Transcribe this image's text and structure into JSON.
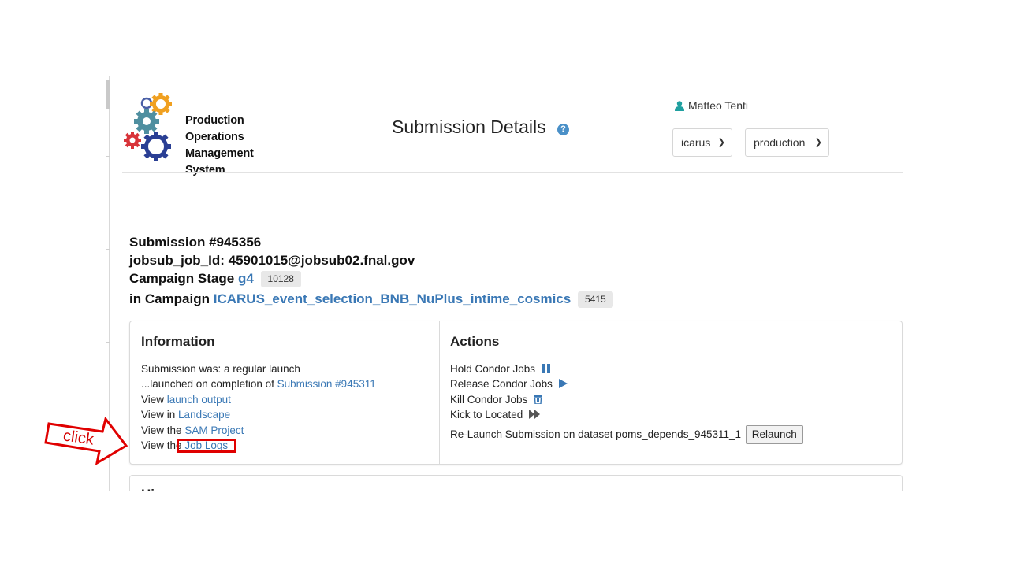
{
  "app": {
    "logo_lines": [
      "Production",
      "Operations",
      "Management",
      "System"
    ],
    "page_title": "Submission Details",
    "help_icon": "question-circle-icon",
    "user_name": "Matteo Tenti",
    "user_icon": "user-icon",
    "experiment_select": "icarus",
    "role_select": "production"
  },
  "submission": {
    "title": "Submission #945356",
    "jobsub_label": "jobsub_job_Id:",
    "jobsub_id": "45901015@jobsub02.fnal.gov",
    "stage_label": "Campaign Stage",
    "stage_name": "g4",
    "stage_id": "10128",
    "campaign_label": "in Campaign",
    "campaign_name": "ICARUS_event_selection_BNB_NuPlus_intime_cosmics",
    "campaign_id": "5415"
  },
  "information": {
    "title": "Information",
    "line1": "Submission was: a regular launch",
    "line2_prefix": "...launched on completion of",
    "line2_link": "Submission #945311",
    "line3_prefix": "View",
    "line3_link": "launch output",
    "line4_prefix": "View in",
    "line4_link": "Landscape",
    "line5_prefix": "View the",
    "line5_link": "SAM Project",
    "line6_prefix": "View the",
    "line6_link": "Job Logs"
  },
  "actions": {
    "title": "Actions",
    "hold": "Hold Condor Jobs",
    "release": "Release Condor Jobs",
    "kill": "Kill Condor Jobs",
    "kick": "Kick to Located",
    "relaunch_text": "Re-Launch Submission on dataset poms_depends_945311_1",
    "relaunch_button": "Relaunch",
    "icons": [
      "pause-icon",
      "play-icon",
      "trash-icon",
      "fast-forward-icon"
    ],
    "icon_color": "#3a78b5"
  },
  "next_panel": {
    "title": "Hi"
  },
  "annotation": {
    "label": "click",
    "color": "#e00000"
  }
}
